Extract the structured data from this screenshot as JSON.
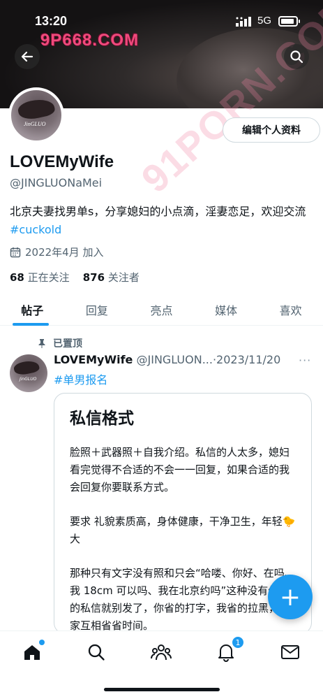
{
  "status_bar": {
    "time": "13:20",
    "network": "5G",
    "battery_level": 0.9
  },
  "watermarks": {
    "top": "9P668.COM",
    "diagonal": "91PORN.COM"
  },
  "header": {
    "back_icon": "arrow-left-icon",
    "search_icon": "search-icon"
  },
  "profile": {
    "avatar_caption": "JinGLUO",
    "edit_label": "编辑个人资料",
    "display_name": "LOVEMyWife",
    "handle": "@JINGLUONaMei",
    "bio_text": "北京夫妻找男单s，分享媳妇的小点滴，淫妻恋足，欢迎交流 ",
    "bio_hashtag": "#cuckold",
    "joined": "2022年4月 加入",
    "following_count": "68",
    "following_label": "正在关注",
    "followers_count": "876",
    "followers_label": "关注者"
  },
  "tabs": [
    {
      "label": "帖子",
      "active": true
    },
    {
      "label": "回复",
      "active": false
    },
    {
      "label": "亮点",
      "active": false
    },
    {
      "label": "媒体",
      "active": false
    },
    {
      "label": "喜欢",
      "active": false
    }
  ],
  "post": {
    "pinned_label": "已置顶",
    "author_name": "LOVEMyWife",
    "author_meta": "@JINGLUON...·2023/11/20",
    "more_icon": "···",
    "hashtag": "#单男报名",
    "card": {
      "title": "私信格式",
      "para1": "脸照＋武器照＋自我介绍。私信的人太多，媳妇看完觉得不合适的不会一一回复，如果合适的我会回复你要联系方式。",
      "para2": "要求 礼貌素质高，身体健康，干净卫生，年轻🐤大",
      "para3": "那种只有文字没有照和只会“哈喽、你好、在吗、我 18cm 可以吗、我在北京约吗”这种没有价值的私信就别发了，你省的打字，我省的拉黑，大家互相省省时间。"
    }
  },
  "fab": {
    "label": "+"
  },
  "bottom_nav": {
    "items": [
      {
        "icon": "home-icon"
      },
      {
        "icon": "search-icon"
      },
      {
        "icon": "communities-icon"
      },
      {
        "icon": "notifications-icon",
        "badge": "1"
      },
      {
        "icon": "messages-icon"
      }
    ]
  }
}
